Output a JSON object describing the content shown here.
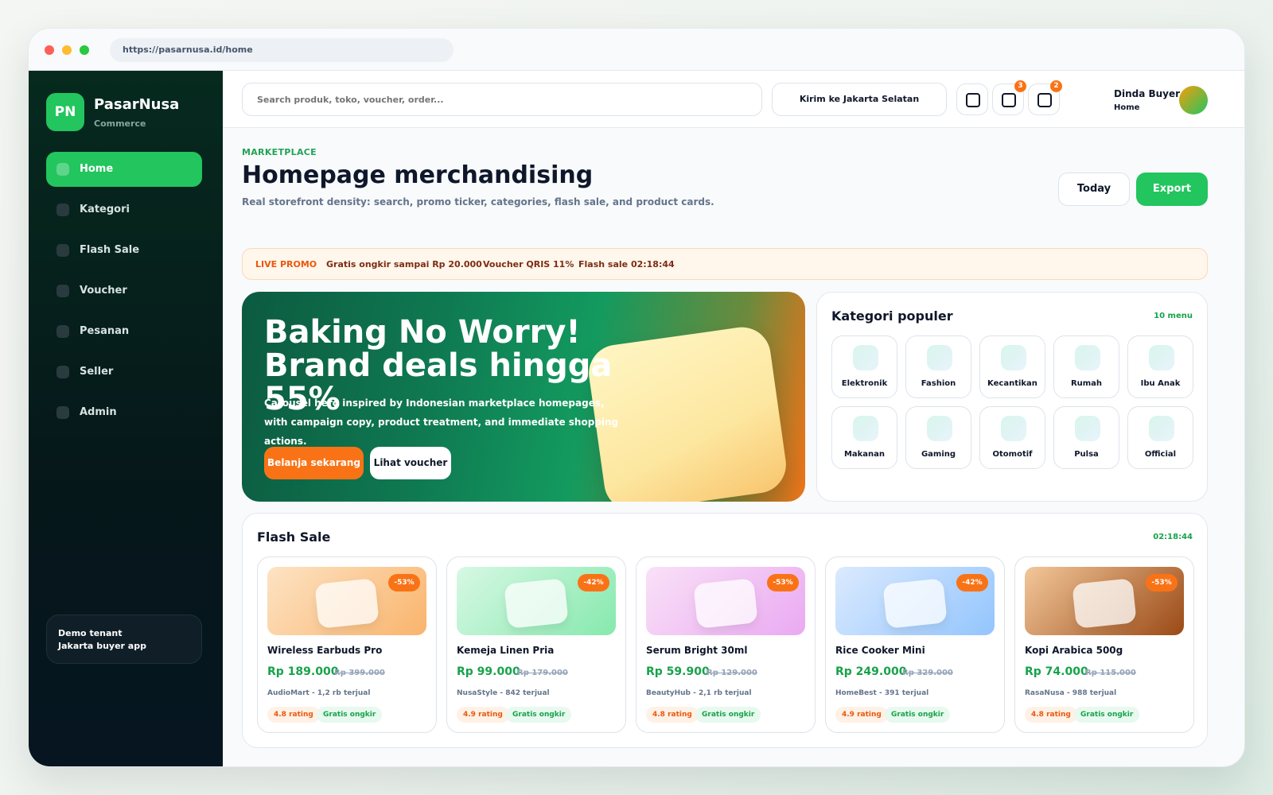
{
  "browser": {
    "url": "https://pasarnusa.id/home"
  },
  "brand": {
    "logo": "PN",
    "name": "PasarNusa",
    "sub": "Commerce"
  },
  "sidebar": {
    "items": [
      {
        "label": "Home"
      },
      {
        "label": "Kategori"
      },
      {
        "label": "Flash Sale"
      },
      {
        "label": "Voucher"
      },
      {
        "label": "Pesanan"
      },
      {
        "label": "Seller"
      },
      {
        "label": "Admin"
      }
    ],
    "tenant": {
      "line1": "Demo tenant",
      "line2": "Jakarta buyer app"
    }
  },
  "topbar": {
    "search_placeholder": "Search produk, toko, voucher, order...",
    "ship_to": "Kirim ke Jakarta Selatan",
    "icons": [
      {
        "name": "square-icon",
        "badge": ""
      },
      {
        "name": "square-icon",
        "badge": "3"
      },
      {
        "name": "square-icon",
        "badge": "2"
      }
    ],
    "user": {
      "name": "Dinda Buyer",
      "role": "Home"
    }
  },
  "header": {
    "eyebrow": "MARKETPLACE",
    "title": "Homepage merchandising",
    "subtitle": "Real storefront density: search, promo ticker, categories, flash sale, and product cards.",
    "today": "Today",
    "export": "Export"
  },
  "ticker": {
    "live": "LIVE PROMO",
    "items": [
      "Gratis ongkir sampai Rp 20.000",
      "Voucher QRIS 11%",
      "Flash sale 02:18:44"
    ]
  },
  "hero": {
    "title": "Baking No Worry! Brand deals hingga 55%",
    "desc": "Carousel hero inspired by Indonesian marketplace homepages, with campaign copy, product treatment, and immediate shopping actions.",
    "primary": "Belanja sekarang",
    "secondary": "Lihat voucher"
  },
  "categories": {
    "title": "Kategori populer",
    "meta": "10 menu",
    "items": [
      "Elektronik",
      "Fashion",
      "Kecantikan",
      "Rumah",
      "Ibu Anak",
      "Makanan",
      "Gaming",
      "Otomotif",
      "Pulsa",
      "Official"
    ]
  },
  "flash": {
    "title": "Flash Sale",
    "timer": "02:18:44",
    "products": [
      {
        "name": "Wireless Earbuds Pro",
        "price": "Rp 189.000",
        "old": "Rp 399.000",
        "discount": "-53%",
        "meta": "AudioMart - 1,2 rb terjual",
        "rating": "4.8 rating",
        "ship": "Gratis ongkir",
        "gradient": [
          "#fde3c4",
          "#f9b46c"
        ]
      },
      {
        "name": "Kemeja Linen Pria",
        "price": "Rp 99.000",
        "old": "Rp 179.000",
        "discount": "-42%",
        "meta": "NusaStyle - 842 terjual",
        "rating": "4.9 rating",
        "ship": "Gratis ongkir",
        "gradient": [
          "#d7f8e4",
          "#86e9ad"
        ]
      },
      {
        "name": "Serum Bright 30ml",
        "price": "Rp 59.900",
        "old": "Rp 129.000",
        "discount": "-53%",
        "meta": "BeautyHub - 2,1 rb terjual",
        "rating": "4.8 rating",
        "ship": "Gratis ongkir",
        "gradient": [
          "#f9e1f7",
          "#eaa9f2"
        ]
      },
      {
        "name": "Rice Cooker Mini",
        "price": "Rp 249.000",
        "old": "Rp 329.000",
        "discount": "-42%",
        "meta": "HomeBest - 391 terjual",
        "rating": "4.9 rating",
        "ship": "Gratis ongkir",
        "gradient": [
          "#dbeafe",
          "#93c5fd"
        ]
      },
      {
        "name": "Kopi Arabica 500g",
        "price": "Rp 74.000",
        "old": "Rp 115.000",
        "discount": "-53%",
        "meta": "RasaNusa - 988 terjual",
        "rating": "4.8 rating",
        "ship": "Gratis ongkir",
        "gradient": [
          "#f3c79a",
          "#9a4a16"
        ]
      }
    ]
  },
  "colors": {
    "accent": "#22c55e",
    "promo": "#f97316",
    "sidebar": "#06171a"
  }
}
